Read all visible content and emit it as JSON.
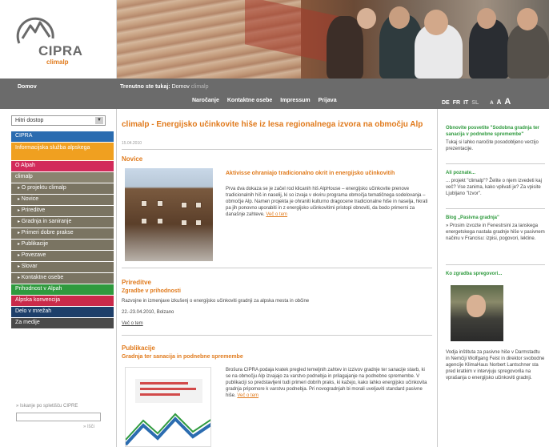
{
  "header": {
    "logo_text": "CIPRA",
    "logo_sub": "climalp",
    "colors": {
      "accent": "#e07a1c",
      "nav_bg": "#6b6b6b"
    }
  },
  "nav": {
    "home": "Domov",
    "crumb_bold": "Trenutno ste tukaj:",
    "crumb_1": "Domov",
    "crumb_2": "climalp",
    "links": [
      "Naročanje",
      "Kontaktne osebe",
      "Impressum",
      "Prijava"
    ],
    "langs": [
      "DE",
      "FR",
      "IT",
      "SL"
    ],
    "font_sizes": [
      "A",
      "A",
      "A"
    ]
  },
  "sidebar": {
    "quick_access": "Hitri dostop",
    "items": [
      {
        "label": "CIPRA",
        "color": "#2b6cb0"
      },
      {
        "label": "Informacijska služba alpskega",
        "color": "#f0a020"
      },
      {
        "label": "O Alpah",
        "color": "#d22a5a"
      },
      {
        "label": "climalp",
        "color": "#8a8470"
      },
      {
        "label": "O projektu climalp",
        "color": "#7a7462"
      },
      {
        "label": "Novice",
        "color": "#7a7462"
      },
      {
        "label": "Prireditve",
        "color": "#7a7462"
      },
      {
        "label": "Gradnja in saniranje",
        "color": "#7a7462"
      },
      {
        "label": "Primeri dobre prakse",
        "color": "#7a7462"
      },
      {
        "label": "Publikacije",
        "color": "#7a7462"
      },
      {
        "label": "Povezave",
        "color": "#7a7462"
      },
      {
        "label": "Slovar",
        "color": "#7a7462"
      },
      {
        "label": "Kontaktne osebe",
        "color": "#7a7462"
      },
      {
        "label": "Prihodnost v Alpah",
        "color": "#2f9a3e"
      },
      {
        "label": "Alpska konvencija",
        "color": "#c92a4a"
      },
      {
        "label": "Delo v mrežah",
        "color": "#1e3f6a"
      },
      {
        "label": "Za medije",
        "color": "#4a4a4a"
      }
    ],
    "search_label": "» Iskanje po spletišču CIPRE",
    "search_go": "» Išči"
  },
  "main": {
    "title": "climalp - Energijsko učinkovite hiše iz lesa regionalnega izvora na območju Alp",
    "date": "15.04.2010",
    "news_label": "Novice",
    "news_headline": "Aktivisse ohraniajo tradicionalno okrit in energijsko učinkovitih",
    "news_body": "Prva dva dokaza se je začel rod klicanih hiš AlpHouse – energijsko učinkovite prenove tradicionalnih hiš in naselij, ki so izvaja v okviru programa območja tematičnega sodelovanja – območje Alp. Namen projekta je ohraniti kulturno dragocene tradicionalne hiše in naselja, hkrati pa jih ponovno uporabiti in z energijsko učinkovitimi pristopi obnoviti, da bodo primerni za današnje zahteve.",
    "news_more": "Več o tem",
    "events_label": "Prireditve",
    "events_sub": "Zgradbe v prihodnosti",
    "events_body": "Razvojne in izmenjave izkušenj o energijsko učinkoviti gradnji za alpska mesta in občine",
    "events_date": "22.-23.04.2010, Bolzano",
    "events_more": "Več o tem",
    "pubs_label": "Publikacije",
    "pubs_sub": "Gradnja ter sanacija in podnebne spremembe",
    "pubs_body": "Brošura CIPRA podaja kratek pregled temeljnih zahtev in izzivov gradnje ter sanacije stavb, ki se na območju Alp izvajajo za varstvo podnebja in prilagajanje na podnebne spremembe. V publikaciji so predstavljeni tudi primeri dobrih praks, ki kažejo, kako lahko energijsko učinkovita gradnja pripomore k varstvu podnebja. Pri novogradnjah bi morali uveljaviti standard pasivne hiše.",
    "pubs_more": "Več o tem"
  },
  "right": {
    "r1_head": "Obnovite posvetite \"Sodobna gradnja ter sanacija v podnebne spremembe\"",
    "r1_body": "Tukaj si lahko naročite posodobljeno verzijo prezentacije.",
    "r2_head": "Ali poznate...",
    "r2_body": "... projekt \"climalp\"? Želite o njem izvedeti kaj več? Vse zanima, kako vplivati je? Za vpisite Ljubljano \"Izvor\".",
    "r2_link": "Tukaj",
    "r3_head": "Blog „Pasivna gradnja\"",
    "r3_body": "» Prosim izvozte in Fenestrsini za lanskega energetskega nastala gradnje hiše v pasivnem načinu v Francisu: izpisi, pogovori, lektine.",
    "r3_link": "» Prosim izvozte",
    "r4_head": "Ko zgradba spregovori...",
    "r4_body": "Vodja inštituta za pasivne hiše v Darmstadtu in Nemčiji Wolfgang Feist in direktor svobodne agencije KlimaHaus Norbert Lantschner sta pred kratkim v intervjuju spregovorila na vprašanja o energijsko učinkoviti gradnji."
  }
}
